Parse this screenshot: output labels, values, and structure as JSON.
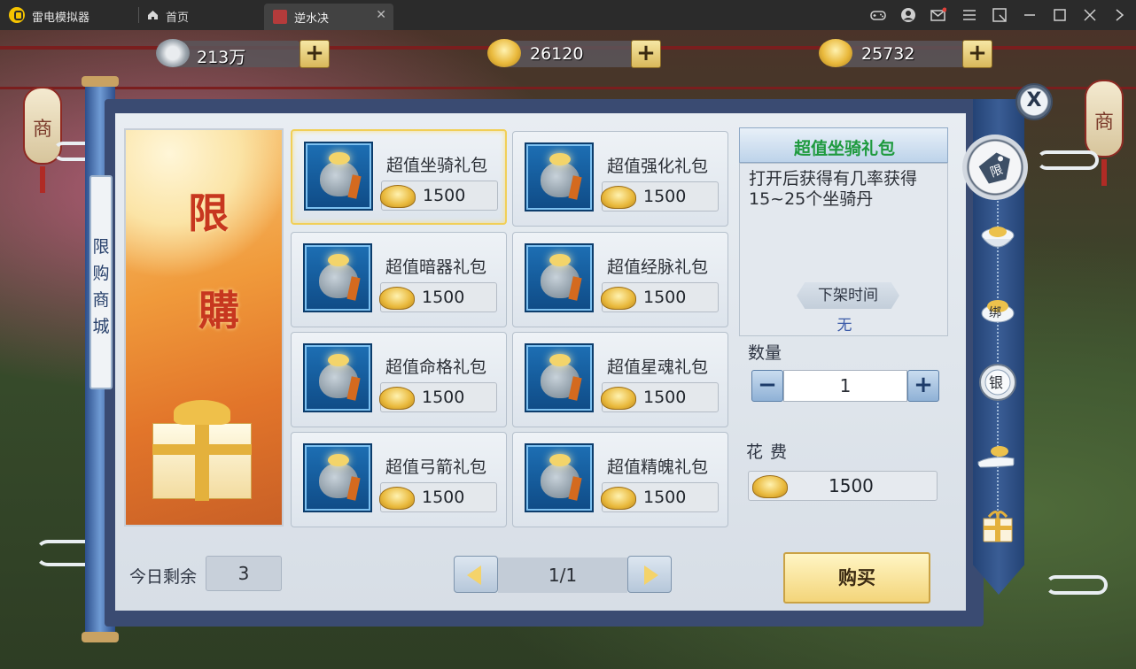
{
  "titlebar": {
    "app_name": "雷电模拟器",
    "home_label": "首页",
    "tab_label": "逆水决",
    "tab_close": "✕",
    "controls": [
      "gamepad-icon",
      "user-icon",
      "mail-icon",
      "menu-icon",
      "screen-icon",
      "minimize-icon",
      "maximize-icon",
      "close-icon"
    ]
  },
  "currencies": [
    {
      "value": "213万",
      "icon": "silver-coin-icon",
      "plus": "+"
    },
    {
      "value": "26120",
      "icon": "bound-ingot-icon",
      "plus": "+"
    },
    {
      "value": "25732",
      "icon": "gold-ingot-icon",
      "plus": "+"
    }
  ],
  "lantern_text": "商",
  "shop": {
    "vertical_title": "限购商城",
    "banner_text": [
      "限",
      "購"
    ],
    "items": [
      {
        "name": "超值坐骑礼包",
        "price": "1500"
      },
      {
        "name": "超值强化礼包",
        "price": "1500"
      },
      {
        "name": "超值暗器礼包",
        "price": "1500"
      },
      {
        "name": "超值经脉礼包",
        "price": "1500"
      },
      {
        "name": "超值命格礼包",
        "price": "1500"
      },
      {
        "name": "超值星魂礼包",
        "price": "1500"
      },
      {
        "name": "超值弓箭礼包",
        "price": "1500"
      },
      {
        "name": "超值精魄礼包",
        "price": "1500"
      }
    ],
    "today_label": "今日剩余",
    "today_value": "3",
    "page": "1/1"
  },
  "detail": {
    "title": "超值坐骑礼包",
    "description": "打开后获得有几率获得15~25个坐骑丹",
    "offline_label": "下架时间",
    "offline_value": "无",
    "quantity_label": "数量",
    "quantity_value": "1",
    "minus": "−",
    "plus": "+",
    "cost_label": "花费",
    "cost_value": "1500",
    "buy_label": "购买"
  },
  "rail": {
    "close": "X",
    "active_tab": "限",
    "tabs": [
      {
        "icon": "ingot-bowl-icon",
        "label": ""
      },
      {
        "icon": "bound-ingot-icon",
        "label": "绑"
      },
      {
        "icon": "silver-coin-icon",
        "label": "银"
      },
      {
        "icon": "hand-ingot-icon",
        "label": ""
      },
      {
        "icon": "gift-box-icon",
        "label": ""
      }
    ]
  },
  "colors": {
    "accent_gold": "#f3d57a",
    "rail_blue": "#3a5d95",
    "title_green": "#1e9a3e"
  }
}
